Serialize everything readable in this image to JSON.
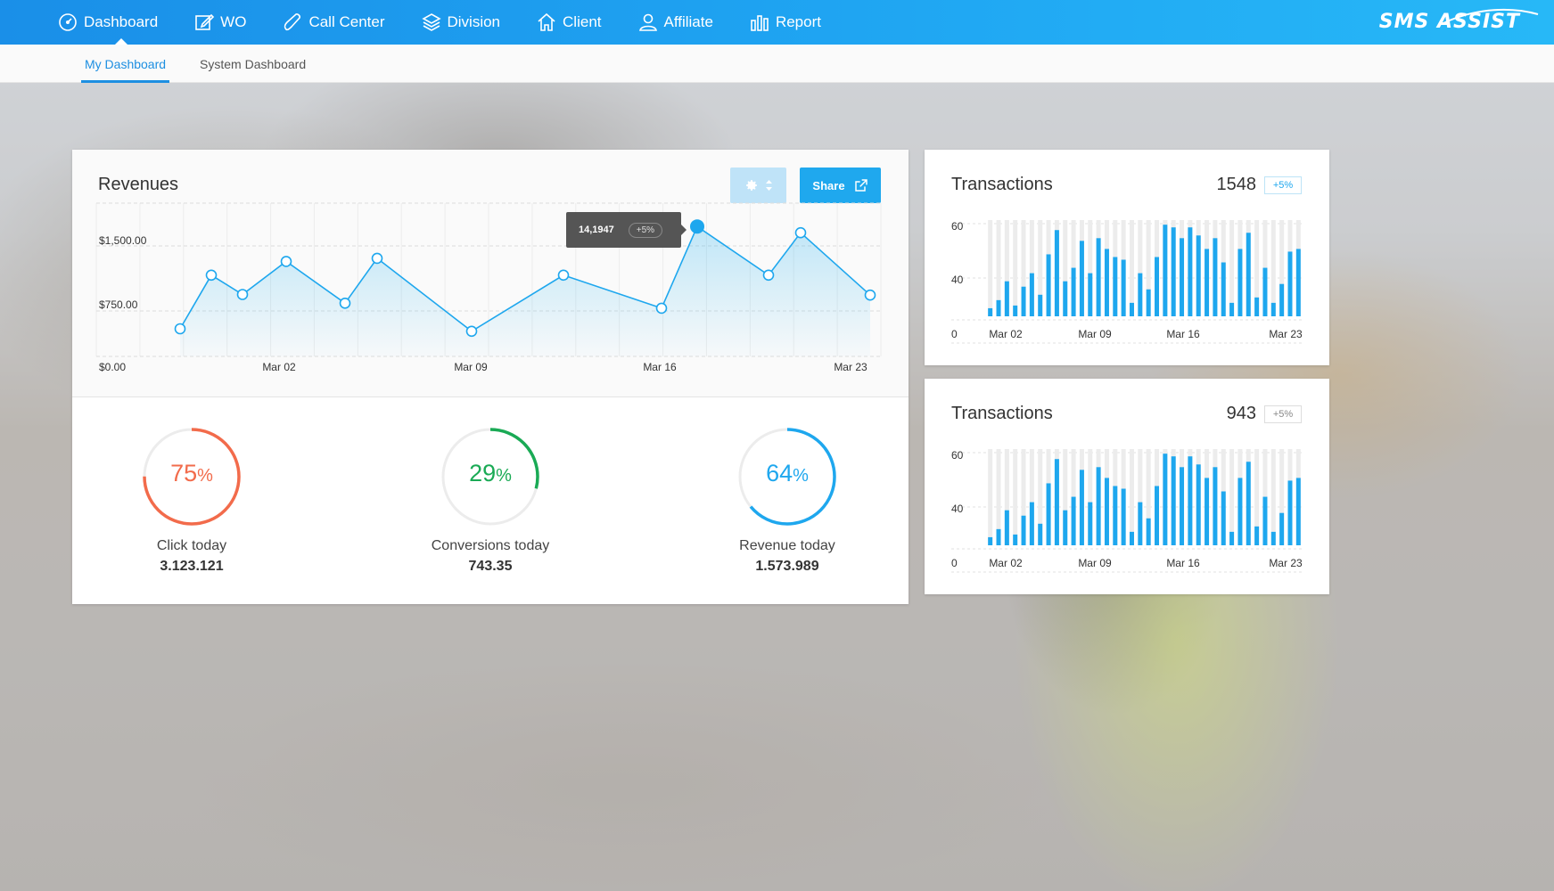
{
  "nav": {
    "items": [
      {
        "label": "Dashboard",
        "icon": "gauge-icon"
      },
      {
        "label": "WO",
        "icon": "edit-icon"
      },
      {
        "label": "Call Center",
        "icon": "phone-icon"
      },
      {
        "label": "Division",
        "icon": "layers-icon"
      },
      {
        "label": "Client",
        "icon": "home-icon"
      },
      {
        "label": "Affiliate",
        "icon": "user-icon"
      },
      {
        "label": "Report",
        "icon": "bar-chart-icon"
      }
    ],
    "logo": "SMS ASSIST"
  },
  "subnav": {
    "tabs": [
      "My Dashboard",
      "System Dashboard"
    ],
    "active": 0
  },
  "revenues": {
    "title": "Revenues",
    "share_label": "Share",
    "tooltip_value": "14,1947",
    "tooltip_change": "+5%",
    "gauges": [
      {
        "pct": "75",
        "pct_value": 75,
        "label": "Click today",
        "value": "3.123.121",
        "color": "#f26b4b"
      },
      {
        "pct": "29",
        "pct_value": 29,
        "label": "Conversions today",
        "value": "743.35",
        "color": "#1aaa55"
      },
      {
        "pct": "64",
        "pct_value": 64,
        "label": "Revenue today",
        "value": "1.573.989",
        "color": "#1ea7ee"
      }
    ],
    "percent_sign": "%"
  },
  "transactions": [
    {
      "title": "Transactions",
      "count": "1548",
      "change": "+5%"
    },
    {
      "title": "Transactions",
      "count": "943",
      "change": "+5%"
    }
  ],
  "colors": {
    "accent": "#1ea7ee",
    "nav_start": "#1a8fe8",
    "nav_end": "#27b8f7"
  },
  "chart_data": [
    {
      "type": "line",
      "title": "Revenues",
      "x_ticks": [
        "Mar 02",
        "Mar 09",
        "Mar 16",
        "Mar 23"
      ],
      "y_ticks": [
        "$0.00",
        "$750.00",
        "$1,500.00"
      ],
      "ylim": [
        0,
        1500
      ],
      "values": [
        100,
        960,
        650,
        1180,
        510,
        1230,
        60,
        960,
        430,
        1740,
        960,
        1640,
        640
      ],
      "highlight_index": 9,
      "grid": true
    },
    {
      "type": "bar",
      "title": "Transactions",
      "y_ticks": [
        "0",
        "40",
        "60"
      ],
      "x_ticks": [
        "Mar 02",
        "Mar 09",
        "Mar 16",
        "Mar 23"
      ],
      "ylim": [
        25,
        60
      ],
      "values": [
        28,
        31,
        38,
        29,
        36,
        41,
        33,
        48,
        57,
        38,
        43,
        53,
        41,
        54,
        50,
        47,
        46,
        30,
        41,
        35,
        47,
        59,
        58,
        54,
        58,
        55,
        50,
        54,
        45,
        30,
        50,
        56,
        32,
        43,
        30,
        37,
        49,
        50
      ],
      "max_background": 60
    },
    {
      "type": "bar",
      "title": "Transactions",
      "y_ticks": [
        "0",
        "40",
        "60"
      ],
      "x_ticks": [
        "Mar 02",
        "Mar 09",
        "Mar 16",
        "Mar 23"
      ],
      "ylim": [
        25,
        60
      ],
      "values": [
        28,
        31,
        38,
        29,
        36,
        41,
        33,
        48,
        57,
        38,
        43,
        53,
        41,
        54,
        50,
        47,
        46,
        30,
        41,
        35,
        47,
        59,
        58,
        54,
        58,
        55,
        50,
        54,
        45,
        30,
        50,
        56,
        32,
        43,
        30,
        37,
        49,
        50
      ],
      "max_background": 60
    }
  ]
}
